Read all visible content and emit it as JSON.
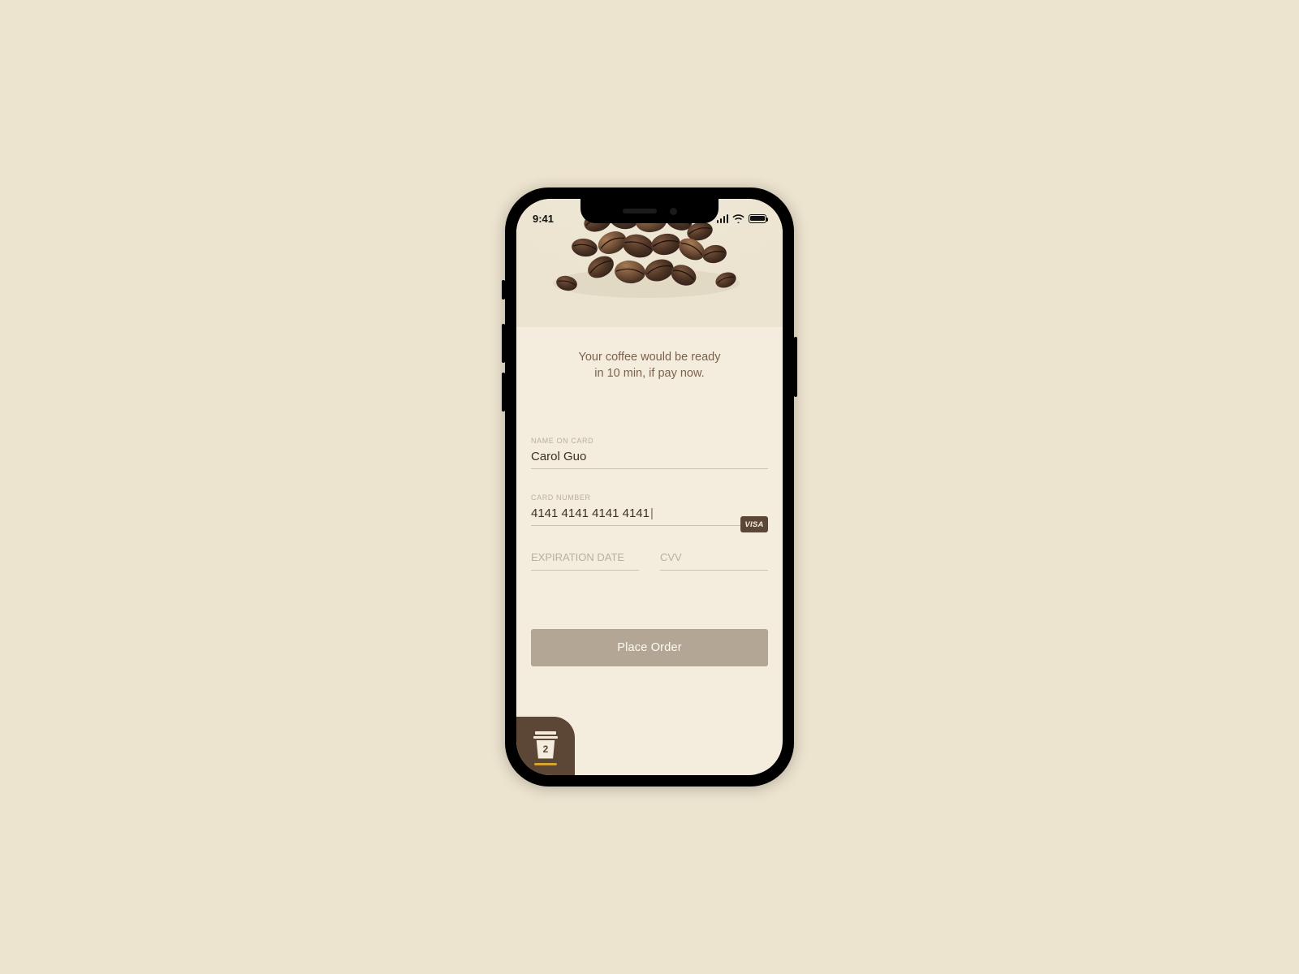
{
  "status": {
    "time": "9:41"
  },
  "hero": {
    "message_line1": "Your coffee would be ready",
    "message_line2": "in 10 min, if pay now."
  },
  "form": {
    "name_label": "NAME ON CARD",
    "name_value": "Carol Guo",
    "card_label": "CARD NUMBER",
    "card_value": "4141 4141 4141 4141",
    "card_brand": "VISA",
    "expiry_placeholder": "EXPIRATION DATE",
    "cvv_placeholder": "CVV"
  },
  "cta": {
    "place_order": "Place Order"
  },
  "cart": {
    "count": "2"
  }
}
